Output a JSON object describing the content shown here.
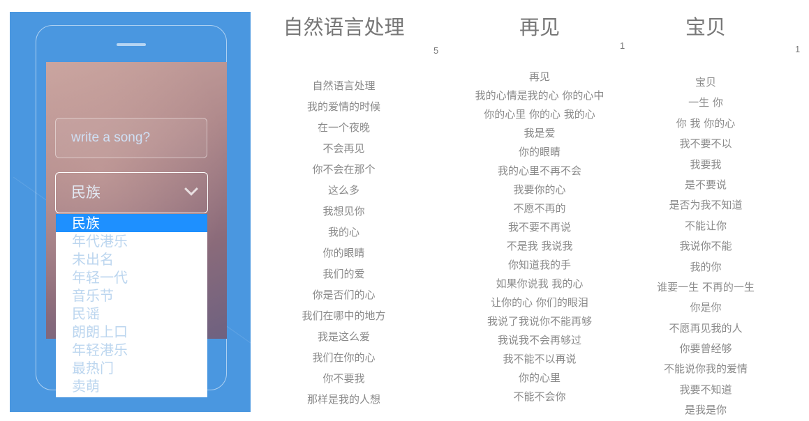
{
  "app": {
    "input_placeholder": "write a song?",
    "select_value": "民族",
    "options": [
      "民族",
      "年代港乐",
      "未出名",
      "年轻一代",
      "音乐节",
      "民谣",
      "朗朗上口",
      "年轻港乐",
      "最热门",
      "卖萌"
    ],
    "selected_index": 0
  },
  "songs": [
    {
      "title": "自然语言处理",
      "count": "5",
      "lines": [
        "自然语言处理",
        "我的爱情的时候",
        "在一个夜晚",
        "不会再见",
        "你不会在那个",
        "这么多",
        "我想见你",
        "我的心",
        "你的眼睛",
        "我们的爱",
        "你是否们的心",
        "我们在哪中的地方",
        "我是这么爱",
        "我们在你的心",
        "你不要我",
        "那样是我的人想"
      ]
    },
    {
      "title": "再见",
      "count": "1",
      "lines": [
        "再见",
        "我的心情是我的心 你的心中",
        "你的心里 你的心 我的心",
        "我是爱",
        "你的眼睛",
        "我的心里不再不会",
        "我要你的心",
        "不愿不再的",
        "我不要不再说",
        "不是我 我说我",
        "你知道我的手",
        "如果你说我 我的心",
        "让你的心 你们的眼泪",
        "我说了我说你不能再够",
        "我说我不会再够过",
        "我不能不以再说",
        "你的心里",
        "不能不会你"
      ]
    },
    {
      "title": "宝贝",
      "count": "1",
      "lines": [
        "宝贝",
        "一生 你",
        "你 我 你的心",
        "我不要不以",
        "我要我",
        "是不要说",
        "是否为我不知道",
        "不能让你",
        "我说你不能",
        "我的你",
        "谁要一生 不再的一生",
        "你是你",
        "不愿再见我的人",
        "你要曾经够",
        "不能说你我的爱情",
        "我要不知道",
        "是我是你"
      ]
    }
  ]
}
